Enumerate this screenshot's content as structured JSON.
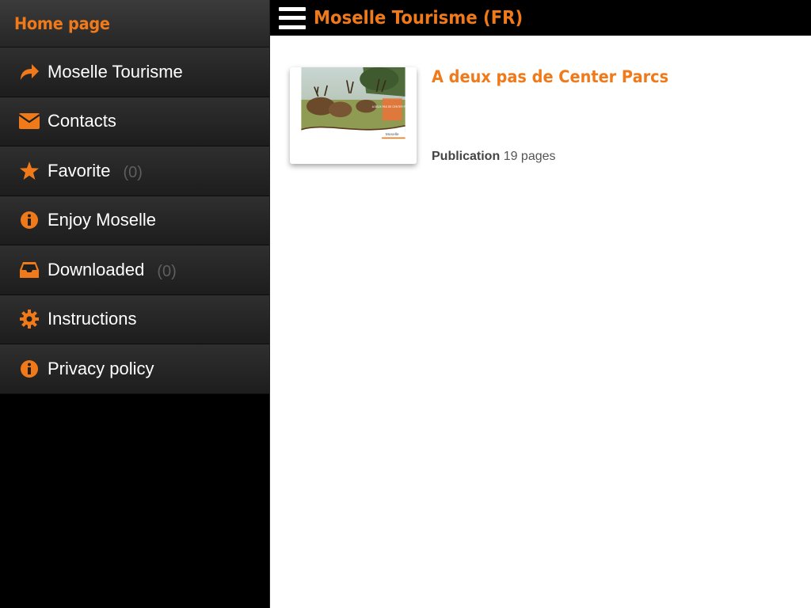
{
  "sidebar": {
    "header": "Home page",
    "items": [
      {
        "label": "Moselle Tourisme",
        "icon": "share-arrow-icon",
        "count": ""
      },
      {
        "label": "Contacts",
        "icon": "envelope-icon",
        "count": ""
      },
      {
        "label": "Favorite",
        "icon": "star-icon",
        "count": "(0)"
      },
      {
        "label": "Enjoy Moselle",
        "icon": "info-icon",
        "count": ""
      },
      {
        "label": "Downloaded",
        "icon": "inbox-icon",
        "count": "(0)"
      },
      {
        "label": "Instructions",
        "icon": "gear-icon",
        "count": ""
      },
      {
        "label": "Privacy policy",
        "icon": "info-icon",
        "count": ""
      }
    ]
  },
  "topbar": {
    "title": "Moselle Tourisme (FR)",
    "menu_icon": "hamburger-menu-icon"
  },
  "publication": {
    "title": "A deux pas de Center Parcs",
    "type_label": "Publication",
    "pages": "19 pages",
    "cover_text": "A DEUX PAS DE CENTER PARCS",
    "cover_brand": "Moselle"
  },
  "colors": {
    "accent": "#f07a1a",
    "sidebar_bg": "#000000",
    "content_bg": "#ffffff"
  }
}
